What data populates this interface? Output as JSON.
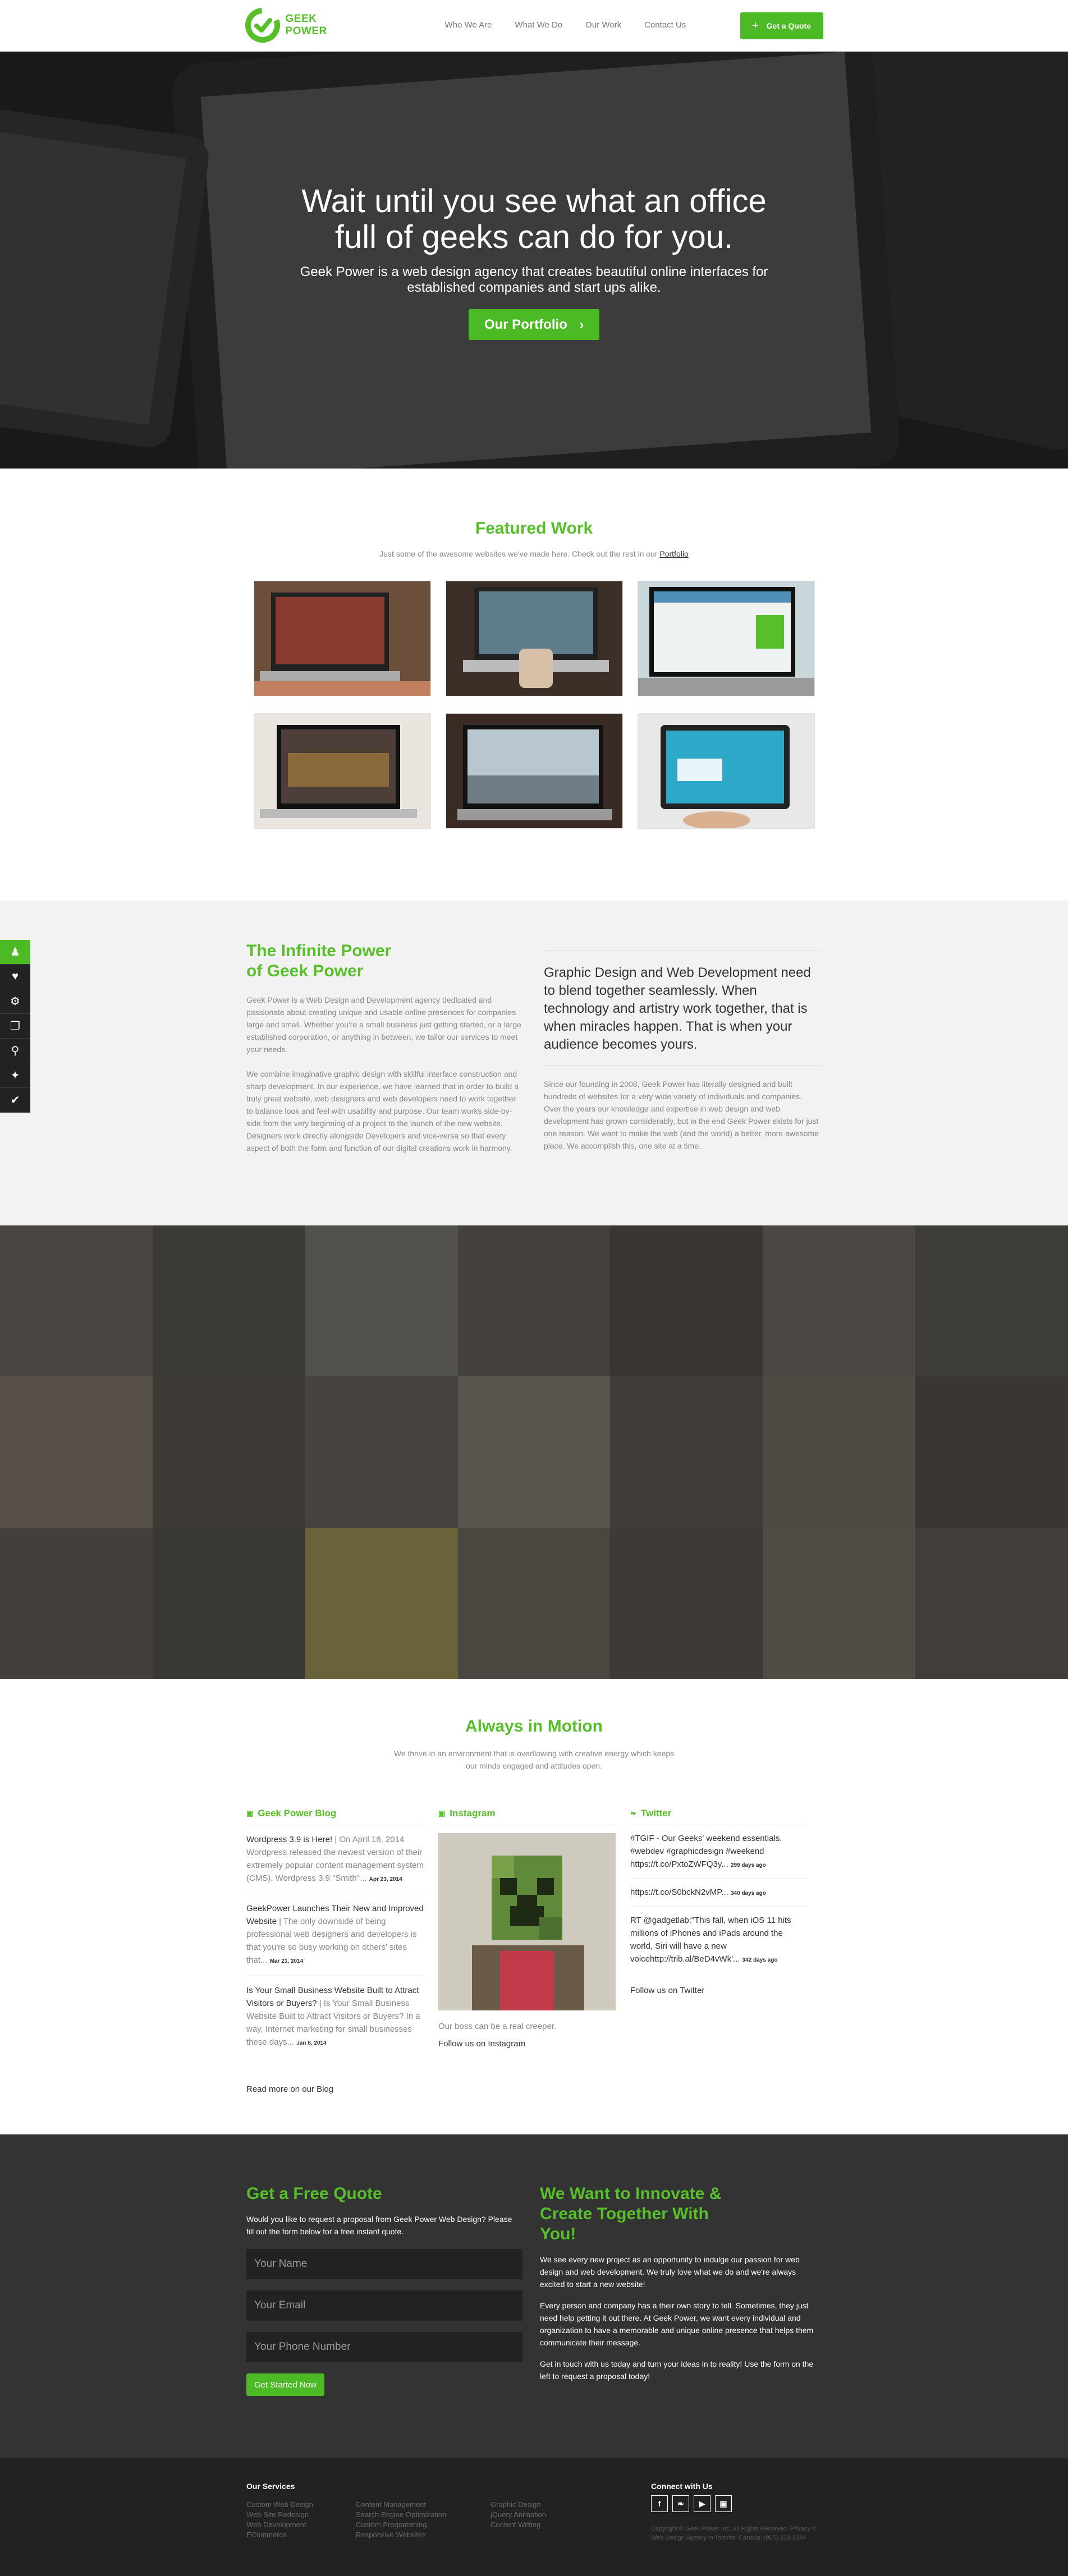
{
  "brand": {
    "line1": "GEEK",
    "line2": "POWER",
    "accent": "#4cba24"
  },
  "nav": {
    "items": [
      "Who We Are",
      "What We Do",
      "Our Work",
      "Contact Us"
    ],
    "quote_label": "Get a Quote"
  },
  "hero": {
    "title": "Wait until you see what an office full of geeks can do for you.",
    "subtitle": "Geek Power is a web design agency that creates beautiful online interfaces for established companies and start ups alike.",
    "button": "Our Portfolio"
  },
  "featured": {
    "title": "Featured Work",
    "sub_text": "Just some of the awesome websites we've made here. Check out the rest in our",
    "sub_link": "Portfolio"
  },
  "side_tools": [
    "person-icon",
    "heart-icon",
    "gear-icon",
    "copy-icon",
    "search-icon",
    "tag-icon",
    "logo-icon"
  ],
  "about": {
    "title": "The Infinite Power of Geek Power",
    "p1": "Geek Power is a Web Design and Development agency dedicated and passionate about creating unique and usable online presences for companies large and small. Whether you're a small business just getting started, or a large established corporation, or anything in between, we tailor our services to meet your needs.",
    "p2": "We combine imaginative graphic design with skillful interface construction and sharp development. In our experience, we have learned that in order to build a truly great website, web designers and web developers need to work together to balance look and feel with usability and purpose. Our team works side-by-side from the very beginning of a project to the launch of the new website. Designers work directly alongside Developers and vice-versa so that every aspect of both the form and function of our digital creations work in harmony.",
    "lead": "Graphic Design and Web Development need to blend together seamlessly. When technology and artistry work together, that is when miracles happen. That is when your audience becomes yours.",
    "p3": "Since our founding in 2008, Geek Power has literally designed and built hundreds of websites for a very wide variety of individuals and companies. Over the years our knowledge and expertise in web design and web development has grown considerably, but in the end Geek Power exists for just one reason. We want to make the web (and the world) a better, more awesome place. We accomplish this, one site at a time."
  },
  "motion": {
    "title": "Always in Motion",
    "sub": "We thrive in an environment that is overflowing with creative energy which keeps our minds engaged and attitudes open.",
    "blog": {
      "head": "Geek Power Blog",
      "items": [
        {
          "title": "Wordpress 3.9 is Here!",
          "text": " | On April 16, 2014 Wordpress released the newest version of their extremely popular content management system (CMS), Wordpress 3.9 \"Smith\"...",
          "date": "Apr 23, 2014"
        },
        {
          "title": "GeekPower Launches Their New and Improved Website",
          "text": " | The only downside of being professional web designers and developers is that you're so busy working on others' sites that...",
          "date": "Mar 21, 2014"
        },
        {
          "title": "Is Your Small Business Website Built to Attract Visitors or Buyers?",
          "text": " | Is Your Small Business Website Built to Attract Visitors or Buyers? In a way, Internet marketing for small businesses these days...",
          "date": "Jan 8, 2014"
        }
      ],
      "more": "Read more on our Blog"
    },
    "instagram": {
      "head": "Instagram",
      "caption": "Our boss can be a real creeper.",
      "follow": "Follow us on Instagram"
    },
    "twitter": {
      "head": "Twitter",
      "tweets": [
        {
          "text": "#TGIF - Our Geeks' weekend essentials. #webdev #graphicdesign #weekend https://t.co/PxtoZWFQ3y...",
          "time": "299 days ago"
        },
        {
          "text": "https://t.co/S0bckN2vMP...",
          "time": "340 days ago"
        },
        {
          "text": "RT @gadgetlab:\"This fall, when iOS 11 hits millions of iPhones and iPads around the world, Siri will have a new voicehttp://trib.al/BeD4vWk'...",
          "time": "342 days ago"
        }
      ],
      "follow": "Follow us on Twitter"
    }
  },
  "quote": {
    "title": "Get a Free Quote",
    "text": "Would you like to request a proposal from Geek Power Web Design? Please fill out the form below for a free instant quote.",
    "name_ph": "Your Name",
    "email_ph": "Your Email",
    "phone_ph": "Your Phone Number",
    "submit": "Get Started Now",
    "right_title": "We Want to Innovate & Create Together With You!",
    "r1": "We see every new project as an opportunity to indulge our passion for web design and web development. We truly love what we do and we're always excited to start a new website!",
    "r2": "Every person and company has a their own story to tell. Sometimes, they just need help getting it out there. At Geek Power, we want every individual and organization to have a memorable and unique online presence that helps them communicate their message.",
    "r3": "Get in touch with us today and turn your ideas in to reality! Use the form on the left to request a proposal today!"
  },
  "footer": {
    "services_head": "Our Services",
    "col1": [
      "Custom Web Design",
      "Web Site Redesign",
      "Web Development",
      "ECommerce"
    ],
    "col2": [
      "Content Management",
      "Search Engine Optimization",
      "Custom Programming",
      "Responsive Websites"
    ],
    "col3": [
      "Graphic Design",
      "jQuery Animation",
      "Content Writing"
    ],
    "connect_head": "Connect with Us",
    "socials": [
      "f",
      "t",
      "yt",
      "ig"
    ],
    "copyright": "Copyright © Geek Power Inc. All Rights Reserved. Privacy © Web Design Agency in Toronto, Canada. (905) 233-3244"
  }
}
